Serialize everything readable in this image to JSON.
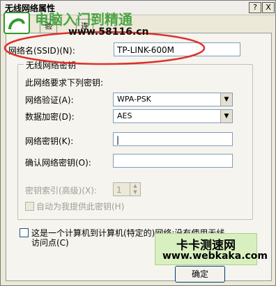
{
  "window": {
    "title": "无线网络属性",
    "help_button": "?",
    "close_button": "X"
  },
  "tabs": [
    {
      "label": "验证"
    },
    {
      "label": "连接"
    }
  ],
  "form": {
    "ssid_label": "网络名(SSID)(N):",
    "ssid_value": "TP-LINK-600M",
    "key_group_title": "无线网络密钥",
    "key_required_text": "此网络要求下列密钥:",
    "auth_label": "网络验证(A):",
    "auth_value": "WPA-PSK",
    "encryption_label": "数据加密(D):",
    "encryption_value": "AES",
    "network_key_label": "网络密钥(K):",
    "network_key_value": "|",
    "confirm_key_label": "确认网络密钥(O):",
    "confirm_key_value": "",
    "key_index_label": "密钥索引(高级)(X):",
    "key_index_value": "1",
    "auto_key_label": "自动为我提供此密钥(H)",
    "adhoc_label_line1": "这是一个计算机到计算机(特定的)网络;没有使用无线",
    "adhoc_label_line2": "访问点(C)"
  },
  "buttons": {
    "ok": "确定"
  },
  "watermarks": {
    "top_brand": "电脑入门到精通",
    "top_url": "www.58116.cn",
    "stamp_title": "卡卡测速网",
    "stamp_url": "www.webkaka.com"
  },
  "colors": {
    "highlight_ellipse": "#e0302a",
    "stamp_bg": "#d8f0bf",
    "brand_green": "#2f9a2a"
  }
}
